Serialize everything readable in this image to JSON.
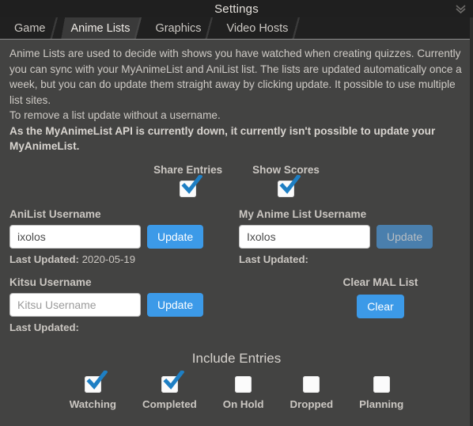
{
  "window": {
    "title": "Settings",
    "close_icon": "close-icon"
  },
  "tabs": [
    {
      "label": "Game",
      "active": false
    },
    {
      "label": "Anime Lists",
      "active": true
    },
    {
      "label": "Graphics",
      "active": false
    },
    {
      "label": "Video Hosts",
      "active": false
    }
  ],
  "intro": {
    "line1": "Anime Lists are used to decide with shows you have watched when creating quizzes. Currently you can sync with your MyAnimeList and AniList list. The lists are updated automatically once a week, but you can do update them straight away by clicking update. It possible to use multiple list sites.",
    "line2": "To remove a list update without a username.",
    "warning": "As the MyAnimeList API is currently down, it currently isn't possible to update your MyAnimeList."
  },
  "top_checkboxes": [
    {
      "label": "Share Entries",
      "checked": true
    },
    {
      "label": "Show Scores",
      "checked": true
    }
  ],
  "accounts": {
    "anilist": {
      "label": "AniList Username",
      "value": "ixolos",
      "placeholder": "AniList Username",
      "button": "Update",
      "button_disabled": false,
      "last_updated_label": "Last Updated:",
      "last_updated_value": "2020-05-19"
    },
    "myanimelist": {
      "label": "My Anime List Username",
      "value": "Ixolos",
      "placeholder": "My Anime List Username",
      "button": "Update",
      "button_disabled": true,
      "last_updated_label": "Last Updated:",
      "last_updated_value": ""
    },
    "kitsu": {
      "label": "Kitsu Username",
      "value": "",
      "placeholder": "Kitsu Username",
      "button": "Update",
      "button_disabled": false,
      "last_updated_label": "Last Updated:",
      "last_updated_value": ""
    }
  },
  "clear_mal": {
    "label": "Clear MAL List",
    "button": "Clear"
  },
  "include_entries": {
    "title": "Include Entries",
    "items": [
      {
        "label": "Watching",
        "checked": true
      },
      {
        "label": "Completed",
        "checked": true
      },
      {
        "label": "On Hold",
        "checked": false
      },
      {
        "label": "Dropped",
        "checked": false
      },
      {
        "label": "Planning",
        "checked": false
      }
    ]
  },
  "colors": {
    "accent_blue": "#3c9ae8",
    "disabled_blue": "#4a7fad",
    "panel_bg": "#434342",
    "titlebar_bg": "#1f1f1f",
    "check_blue": "#1e7fc4"
  }
}
